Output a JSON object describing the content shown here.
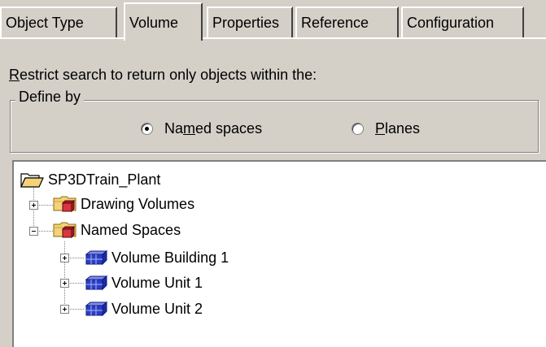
{
  "tabs": [
    {
      "label": "Object Type",
      "active": false
    },
    {
      "label": "Volume",
      "active": true
    },
    {
      "label": "Properties",
      "active": false
    },
    {
      "label": "Reference",
      "active": false
    },
    {
      "label": "Configuration",
      "active": false
    }
  ],
  "restrict": {
    "pre": "R",
    "post": "estrict search to return only objects within the:"
  },
  "group": {
    "legend": "Define by",
    "radio_named": {
      "pre": "Na",
      "mn": "m",
      "post": "ed spaces",
      "checked": true
    },
    "radio_planes": {
      "pre": "",
      "mn": "P",
      "post": "lanes",
      "checked": false
    }
  },
  "tree": {
    "root": "SP3DTrain_Plant",
    "items": [
      {
        "label": "Drawing Volumes",
        "icon": "folder-volume-icon",
        "expanded": false
      },
      {
        "label": "Named Spaces",
        "icon": "folder-volume-icon",
        "expanded": true
      },
      {
        "label": "Volume Building 1",
        "icon": "volume-icon",
        "expanded": false
      },
      {
        "label": "Volume Unit 1",
        "icon": "volume-icon",
        "expanded": false
      },
      {
        "label": "Volume Unit 2",
        "icon": "volume-icon",
        "expanded": false
      }
    ]
  },
  "colors": {
    "dialog_bg": "#d4d0c8",
    "tree_bg": "#ffffff",
    "volume_icon": "#2a3fc0",
    "folder": "#f4d27a"
  }
}
